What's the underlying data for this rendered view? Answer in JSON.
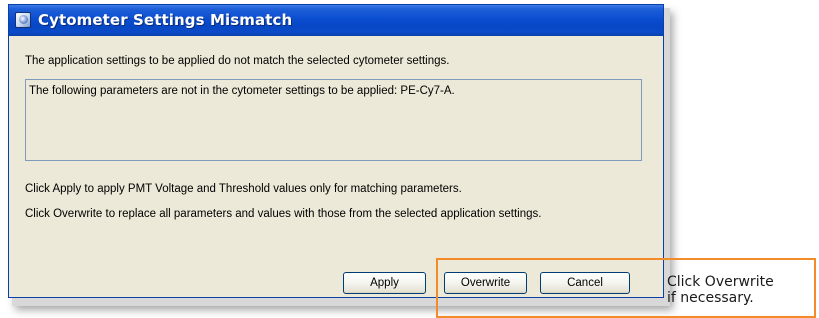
{
  "dialog": {
    "title": "Cytometer Settings Mismatch",
    "intro": "The application settings to be applied do not match the selected cytometer settings.",
    "message": "The following parameters are not in the cytometer settings to be applied: PE-Cy7-A.",
    "instruction_apply": "Click Apply to apply PMT Voltage and Threshold values only for matching parameters.",
    "instruction_overwrite": "Click Overwrite to replace all parameters and values with those from the selected application settings."
  },
  "buttons": {
    "apply": "Apply",
    "overwrite": "Overwrite",
    "cancel": "Cancel"
  },
  "callout": {
    "line1": "Click Overwrite",
    "line2": "if necessary."
  },
  "colors": {
    "titlebar": "#0a4dd0",
    "window_bg": "#ece9d8",
    "callout_border": "#f28c28"
  }
}
